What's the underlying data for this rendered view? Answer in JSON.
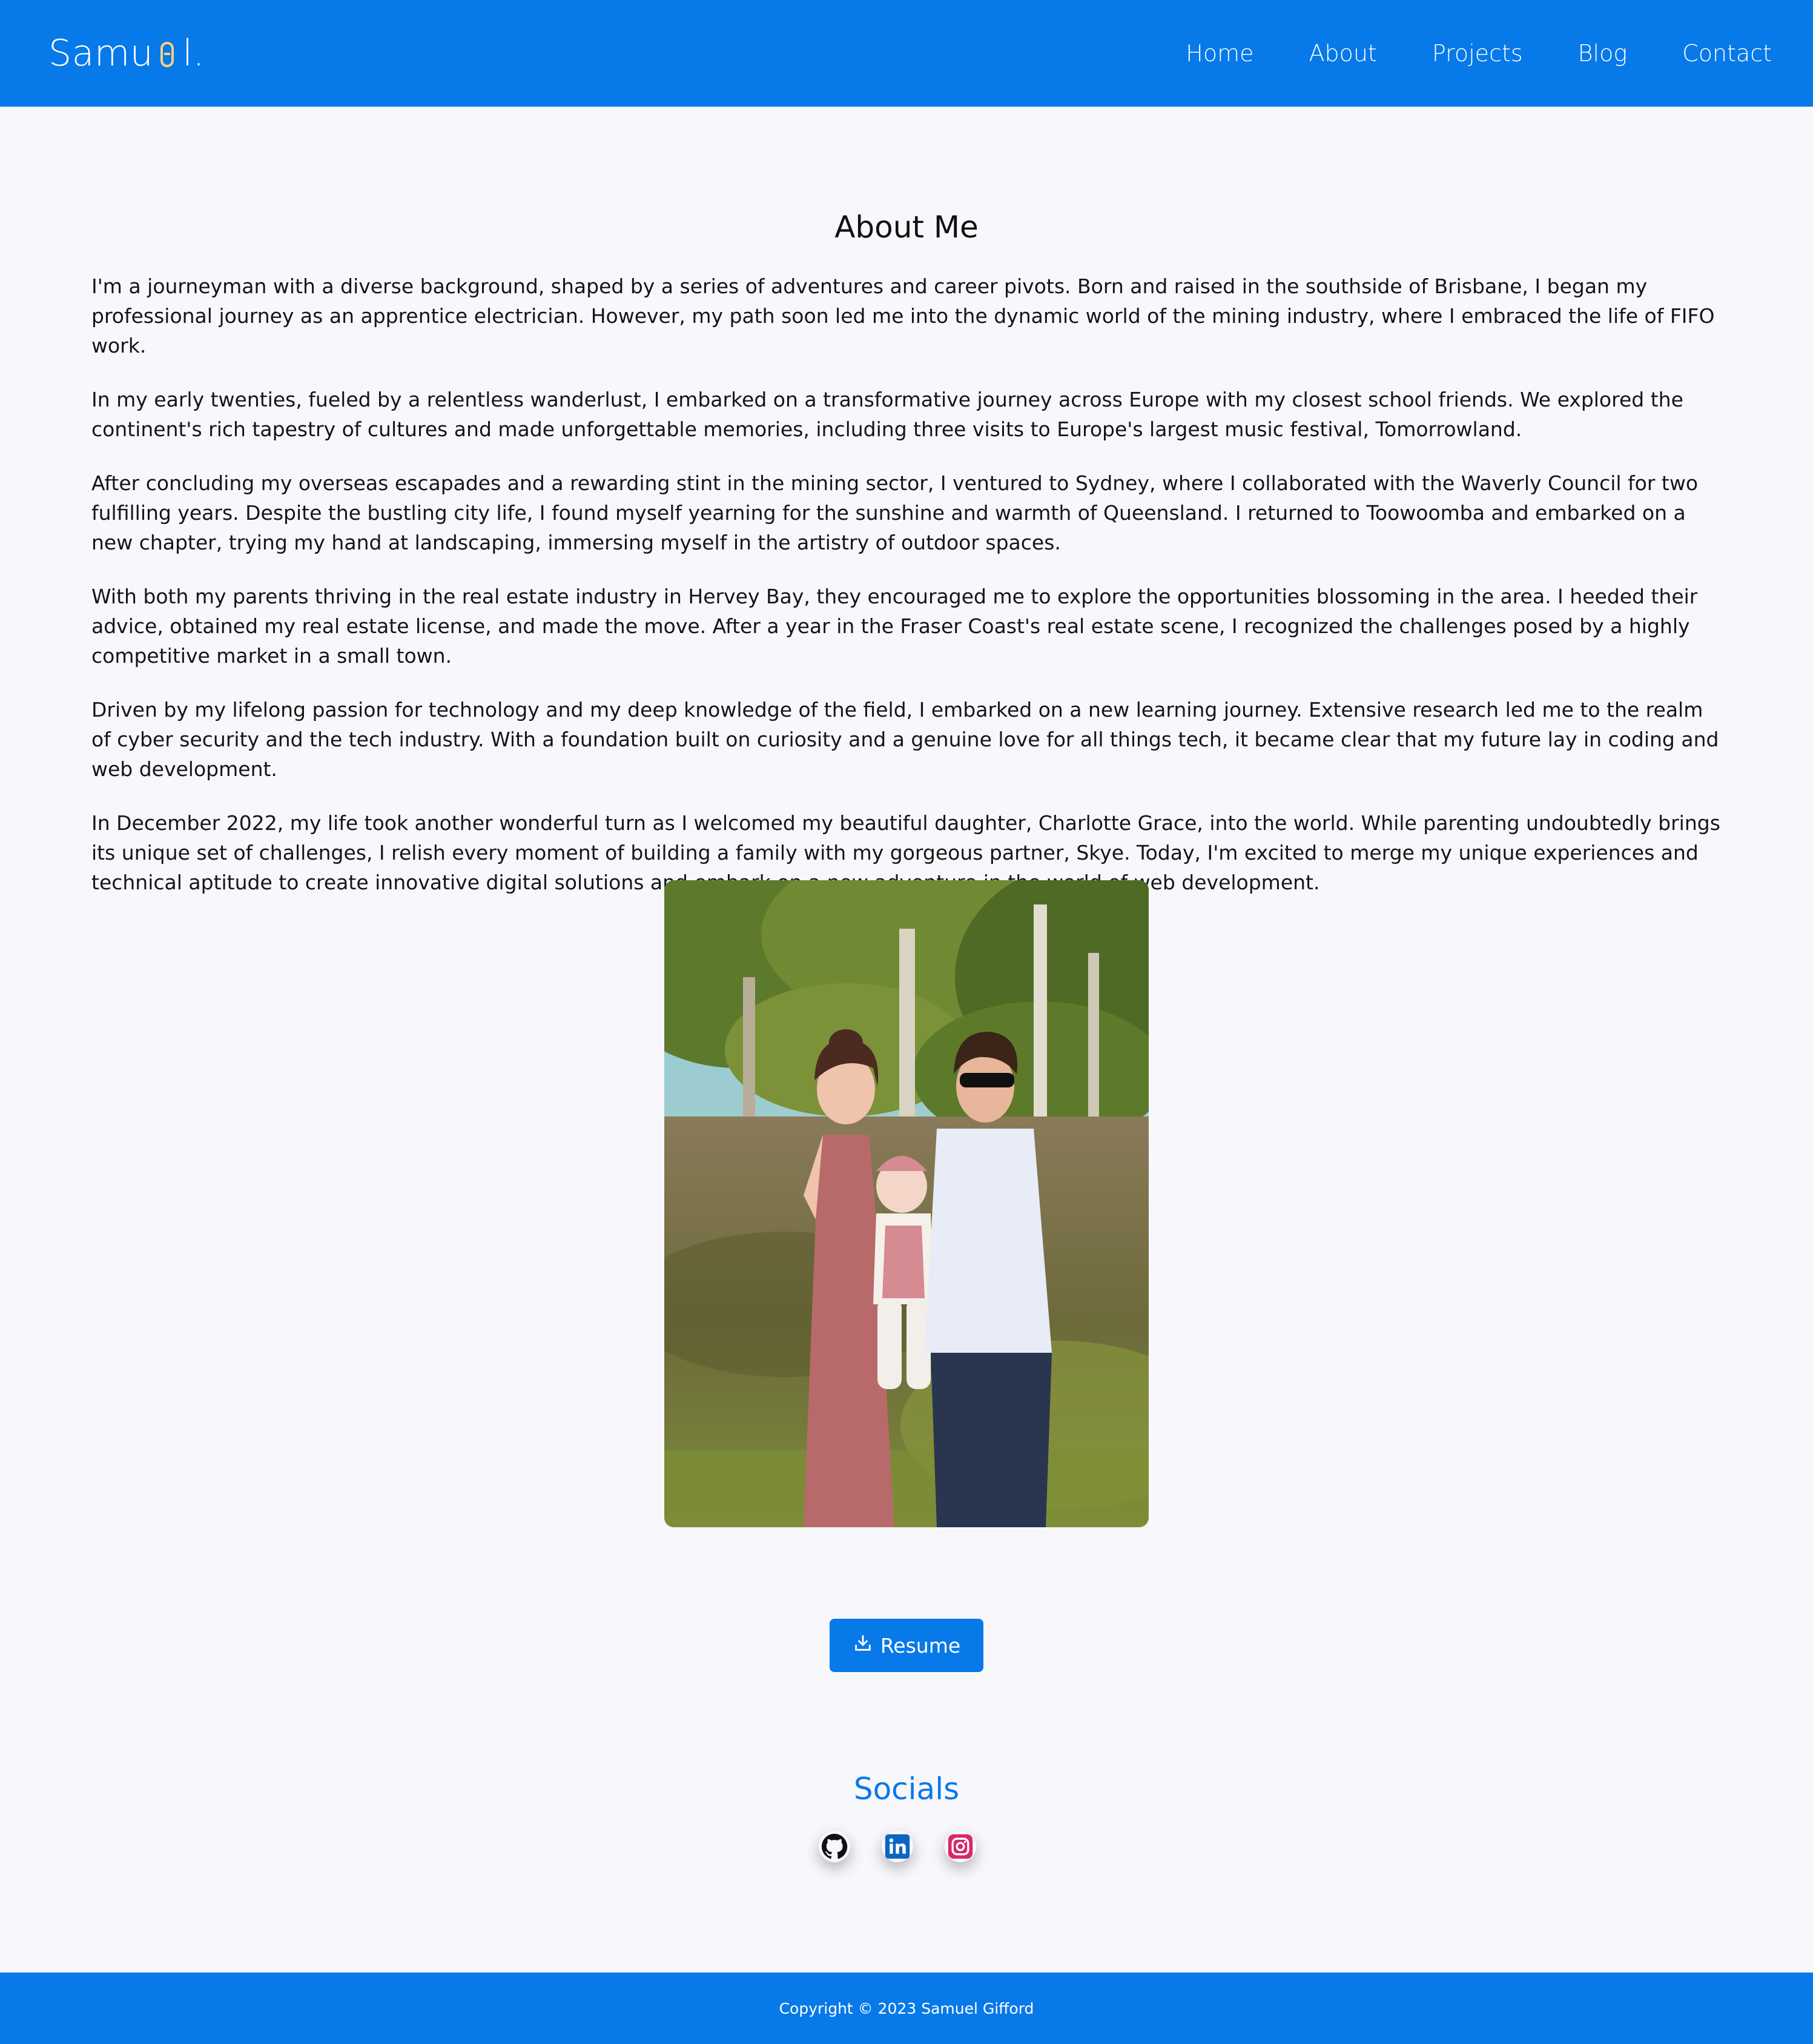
{
  "brand": {
    "text_start": "Samu",
    "text_end": "l."
  },
  "nav": {
    "items": [
      {
        "label": "Home"
      },
      {
        "label": "About"
      },
      {
        "label": "Projects"
      },
      {
        "label": "Blog"
      },
      {
        "label": "Contact"
      }
    ]
  },
  "about": {
    "title": "About Me",
    "paragraphs": [
      "I'm a journeyman with a diverse background, shaped by a series of adventures and career pivots. Born and raised in the southside of Brisbane, I began my professional journey as an apprentice electrician. However, my path soon led me into the dynamic world of the mining industry, where I embraced the life of FIFO work.",
      "In my early twenties, fueled by a relentless wanderlust, I embarked on a transformative journey across Europe with my closest school friends. We explored the continent's rich tapestry of cultures and made unforgettable memories, including three visits to Europe's largest music festival, Tomorrowland.",
      "After concluding my overseas escapades and a rewarding stint in the mining sector, I ventured to Sydney, where I collaborated with the Waverly Council for two fulfilling years. Despite the bustling city life, I found myself yearning for the sunshine and warmth of Queensland. I returned to Toowoomba and embarked on a new chapter, trying my hand at landscaping, immersing myself in the artistry of outdoor spaces.",
      "With both my parents thriving in the real estate industry in Hervey Bay, they encouraged me to explore the opportunities blossoming in the area. I heeded their advice, obtained my real estate license, and made the move. After a year in the Fraser Coast's real estate scene, I recognized the challenges posed by a highly competitive market in a small town.",
      "Driven by my lifelong passion for technology and my deep knowledge of the field, I embarked on a new learning journey. Extensive research led me to the realm of cyber security and the tech industry. With a foundation built on curiosity and a genuine love for all things tech, it became clear that my future lay in coding and web development.",
      "In December 2022, my life took another wonderful turn as I welcomed my beautiful daughter, Charlotte Grace, into the world. While parenting undoubtedly brings its unique set of challenges, I relish every moment of building a family with my gorgeous partner, Skye. Today, I'm excited to merge my unique experiences and technical aptitude to create innovative digital solutions and embark on a new adventure in the world of web development."
    ]
  },
  "resume": {
    "label": "Resume",
    "icon": "download-icon"
  },
  "socials": {
    "title": "Socials",
    "items": [
      {
        "icon": "github-icon",
        "color": "#111111"
      },
      {
        "icon": "linkedin-icon",
        "color": "#0a66c2"
      },
      {
        "icon": "instagram-icon",
        "color": "#d6286a"
      }
    ]
  },
  "footer": {
    "copyright": "Copyright © 2023 Samuel Gifford"
  },
  "colors": {
    "primary": "#0779e9",
    "background": "#f8f7fc"
  }
}
